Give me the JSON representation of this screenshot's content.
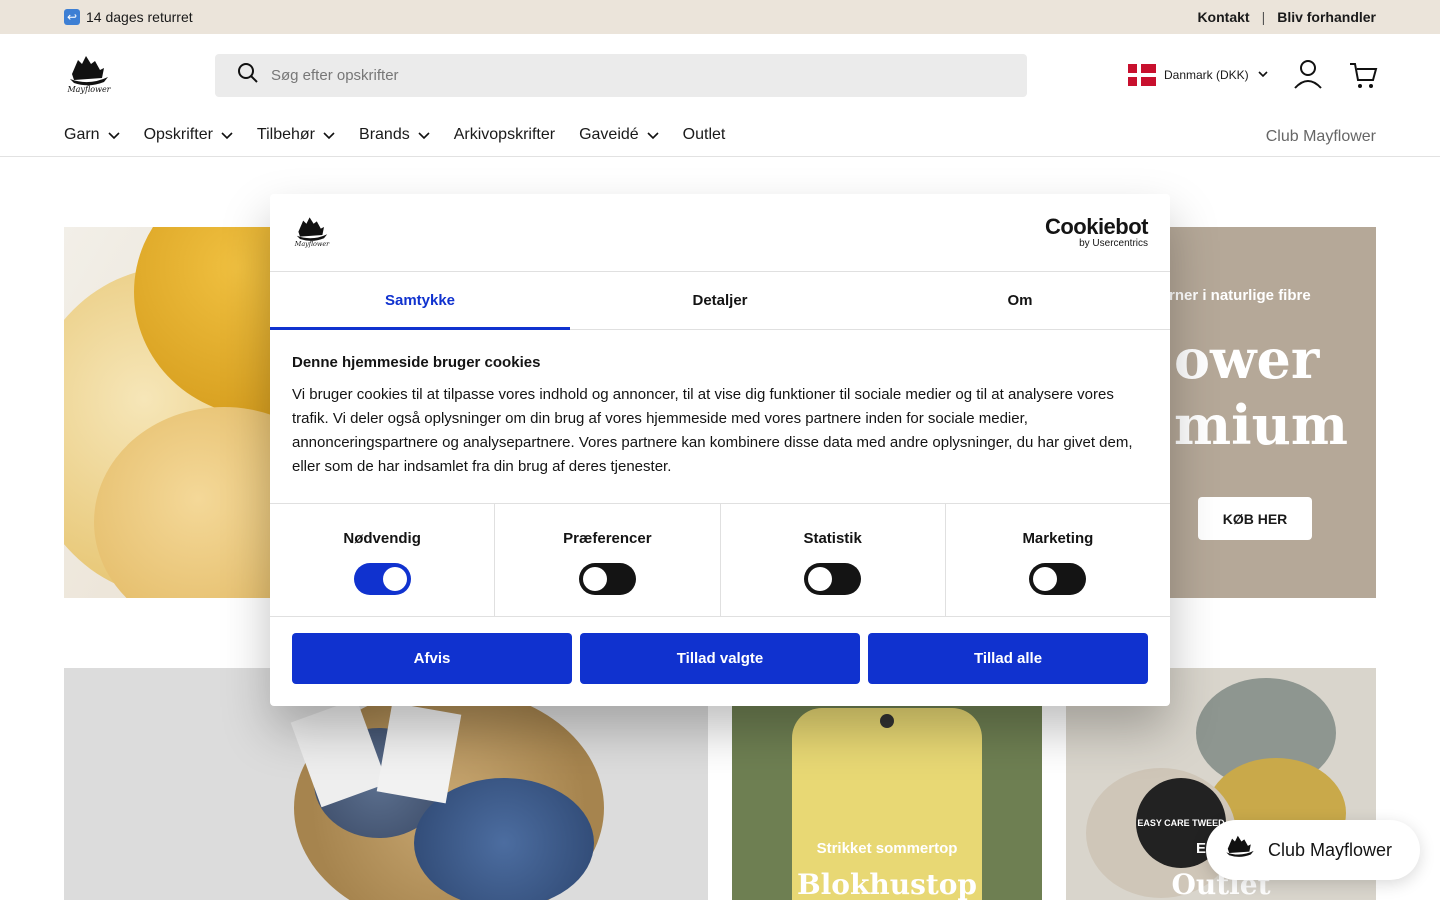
{
  "announcement": {
    "left_text": "14 dages returret",
    "links": [
      "Kontakt",
      "Bliv forhandler"
    ],
    "separator": "|"
  },
  "header": {
    "logo_text": "Mayflower",
    "search_placeholder": "Søg efter opskrifter",
    "country_label": "Danmark (DKK)",
    "icons": [
      "search-icon",
      "flag-dk-icon",
      "chevron-down-icon",
      "account-icon",
      "cart-icon"
    ]
  },
  "nav": {
    "items": [
      {
        "label": "Garn",
        "has_dropdown": true
      },
      {
        "label": "Opskrifter",
        "has_dropdown": true
      },
      {
        "label": "Tilbehør",
        "has_dropdown": true
      },
      {
        "label": "Brands",
        "has_dropdown": true
      },
      {
        "label": "Arkivopskrifter",
        "has_dropdown": false
      },
      {
        "label": "Gaveidé",
        "has_dropdown": true
      },
      {
        "label": "Outlet",
        "has_dropdown": false
      }
    ],
    "club_link": "Club Mayflower"
  },
  "hero": {
    "eyebrow": "rner i naturlige fibre",
    "line1": "ower",
    "line2": "mium",
    "button": "KØB HER"
  },
  "cards": [
    {
      "eyebrow": "",
      "title": ""
    },
    {
      "eyebrow": "Strikket sommertop",
      "title": "Blokhustop"
    },
    {
      "eyebrow": "Easy C",
      "title": "Outlet",
      "badge": "EASY CARE TWEED"
    }
  ],
  "cookie_dialog": {
    "brand": "Cookiebot",
    "brand_sub": "by Usercentrics",
    "tabs": [
      {
        "label": "Samtykke",
        "active": true
      },
      {
        "label": "Detaljer",
        "active": false
      },
      {
        "label": "Om",
        "active": false
      }
    ],
    "heading": "Denne hjemmeside bruger cookies",
    "body": "Vi bruger cookies til at tilpasse vores indhold og annoncer, til at vise dig funktioner til sociale medier og til at analysere vores trafik. Vi deler også oplysninger om din brug af vores hjemmeside med vores partnere inden for sociale medier, annonceringspartnere og analysepartnere. Vores partnere kan kombinere disse data med andre oplysninger, du har givet dem, eller som de har indsamlet fra din brug af deres tjenester.",
    "toggles": [
      {
        "label": "Nødvendig",
        "on": true
      },
      {
        "label": "Præferencer",
        "on": false
      },
      {
        "label": "Statistik",
        "on": false
      },
      {
        "label": "Marketing",
        "on": false
      }
    ],
    "buttons": [
      "Afvis",
      "Tillad valgte",
      "Tillad alle"
    ],
    "accent_color": "#1032cf"
  },
  "club_fab": {
    "label": "Club Mayflower"
  }
}
